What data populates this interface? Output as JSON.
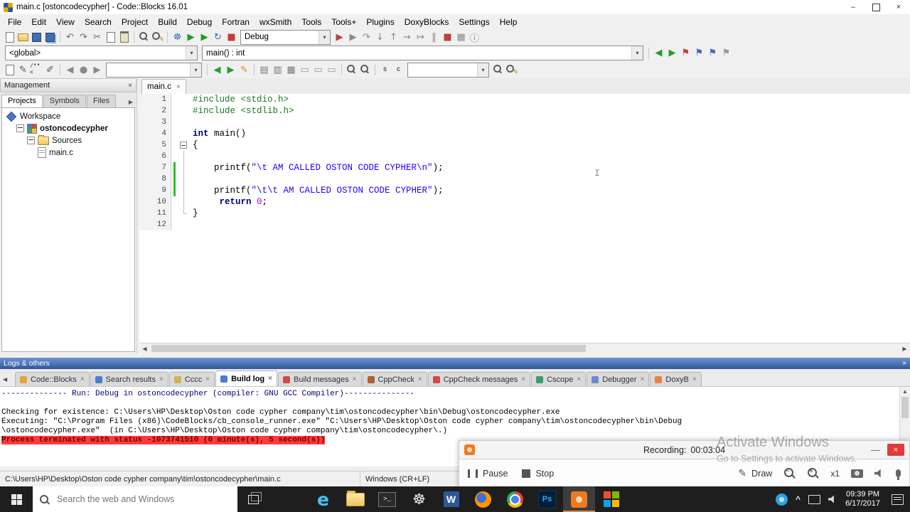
{
  "window": {
    "title": "main.c [ostoncodecypher] - Code::Blocks 16.01",
    "minimize": "–",
    "close": "×"
  },
  "menubar": {
    "items": [
      "File",
      "Edit",
      "View",
      "Search",
      "Project",
      "Build",
      "Debug",
      "Fortran",
      "wxSmith",
      "Tools",
      "Tools+",
      "Plugins",
      "DoxyBlocks",
      "Settings",
      "Help"
    ]
  },
  "toolbars": {
    "row1_file": [
      {
        "name": "new-file-icon",
        "shape": "doc"
      },
      {
        "name": "open-file-icon",
        "shape": "folder"
      },
      {
        "name": "save-file-icon",
        "shape": "floppy"
      },
      {
        "name": "save-all-files-icon",
        "shape": "floppy2"
      }
    ],
    "row1_edit": [
      {
        "name": "undo-icon",
        "glyph": "↶"
      },
      {
        "name": "redo-icon",
        "glyph": "↷"
      },
      {
        "name": "cut-icon",
        "glyph": "✂"
      },
      {
        "name": "copy-icon",
        "shape": "doc"
      },
      {
        "name": "paste-icon",
        "shape": "clip"
      }
    ],
    "row1_find": [
      {
        "name": "find-icon",
        "shape": "mag"
      },
      {
        "name": "replace-icon",
        "shape": "magpen"
      }
    ],
    "row1_build": [
      {
        "name": "build-icon",
        "glyph": "☸",
        "color": "#3f6fb5"
      },
      {
        "name": "run-icon",
        "glyph": "▶",
        "color": "#18a018"
      },
      {
        "name": "build-and-run-icon",
        "glyph": "▶",
        "color": "#18a018"
      },
      {
        "name": "rebuild-icon",
        "glyph": "↻",
        "color": "#3f6fb5"
      },
      {
        "name": "abort-build-icon",
        "glyph": "■",
        "color": "#c43c3c"
      }
    ],
    "debug_target": "Debug",
    "row1_debug": [
      {
        "name": "debug-continue-icon",
        "glyph": "▶",
        "color": "#c43c3c"
      },
      {
        "name": "run-to-cursor-icon",
        "glyph": "▶",
        "color": "#8a8a8a"
      },
      {
        "name": "next-line-icon",
        "glyph": "↷",
        "color": "#8a8a8a"
      },
      {
        "name": "step-into-icon",
        "glyph": "↓",
        "color": "#8a8a8a"
      },
      {
        "name": "step-out-icon",
        "glyph": "↑",
        "color": "#8a8a8a"
      },
      {
        "name": "next-instruction-icon",
        "glyph": "→",
        "color": "#8a8a8a"
      },
      {
        "name": "step-into-instruction-icon",
        "glyph": "↦",
        "color": "#8a8a8a"
      },
      {
        "name": "break-debugger-icon",
        "glyph": "‖",
        "color": "#8a8a8a"
      },
      {
        "name": "stop-debugger-icon",
        "glyph": "■",
        "color": "#c43c3c"
      },
      {
        "name": "debugging-windows-icon",
        "glyph": "▦",
        "color": "#8a8a8a"
      },
      {
        "name": "debug-info-icon",
        "glyph": "ⓘ",
        "color": "#8a8a8a"
      }
    ],
    "scope_combo": "<global>",
    "function_combo": "main() : int",
    "row2_icons": [
      {
        "name": "goto-prev-function-icon",
        "glyph": "◀",
        "color": "#2a9c2a"
      },
      {
        "name": "goto-next-function-icon",
        "glyph": "▶",
        "color": "#2a9c2a"
      },
      {
        "name": "toggle-bookmark-icon",
        "glyph": "⚑",
        "color": "#c43c3c"
      },
      {
        "name": "prev-bookmark-icon",
        "glyph": "⚑",
        "color": "#3f6fb5"
      },
      {
        "name": "next-bookmark-icon",
        "glyph": "⚑",
        "color": "#3f6fb5"
      },
      {
        "name": "clear-bookmarks-icon",
        "glyph": "⚑",
        "color": "#9a9a9a"
      }
    ],
    "row3_doxy": [
      {
        "name": "doxy-extract-icon",
        "shape": "doc"
      },
      {
        "name": "doxy-wizard-icon",
        "glyph": "✎",
        "color": "#555555"
      },
      {
        "name": "doxy-block-comment-icon",
        "glyph": "/**<",
        "text_icon": true
      },
      {
        "name": "doxy-line-comment-icon",
        "glyph": "✐",
        "color": "#555555"
      }
    ],
    "row3_nav": [
      {
        "name": "browse-back-icon",
        "glyph": "◀",
        "color": "#8a8a8a"
      },
      {
        "name": "browse-marker-icon",
        "glyph": "●",
        "color": "#8a8a8a"
      },
      {
        "name": "browse-forward-icon",
        "glyph": "▶",
        "color": "#8a8a8a"
      }
    ],
    "row3_combo1": "",
    "row3_edit": [
      {
        "name": "jump-back-icon",
        "glyph": "◀",
        "color": "#2a9c2a"
      },
      {
        "name": "jump-forward-icon",
        "glyph": "▶",
        "color": "#2a9c2a"
      },
      {
        "name": "highlight-pen-icon",
        "glyph": "✎",
        "color": "#c09a10"
      }
    ],
    "row3_align": [
      {
        "name": "align-box-1-icon",
        "glyph": "▤",
        "color": "#777777"
      },
      {
        "name": "align-box-2-icon",
        "glyph": "▥",
        "color": "#777777"
      },
      {
        "name": "align-box-3-icon",
        "glyph": "▦",
        "color": "#777777"
      },
      {
        "name": "frame-1-icon",
        "glyph": "▭",
        "color": "#9a9a9a"
      },
      {
        "name": "frame-2-icon",
        "glyph": "▭",
        "color": "#9a9a9a"
      },
      {
        "name": "frame-3-icon",
        "glyph": "▭",
        "color": "#9a9a9a"
      }
    ],
    "row3_zoom": [
      {
        "name": "zoom-out-icon",
        "shape": "mag"
      },
      {
        "name": "zoom-in-icon",
        "shape": "mag"
      }
    ],
    "row3_letters": [
      {
        "name": "style-s-icon",
        "glyph": "S",
        "text_icon": true
      },
      {
        "name": "style-c-icon",
        "glyph": "C",
        "text_icon": true
      }
    ],
    "row3_combo2": "",
    "row3_search": [
      {
        "name": "search-files-icon",
        "shape": "mag"
      },
      {
        "name": "search-replace-files-icon",
        "shape": "magpen"
      }
    ]
  },
  "management": {
    "title": "Management",
    "close": "×",
    "overflow": "▶",
    "tabs": [
      {
        "label": "Projects",
        "active": true
      },
      {
        "label": "Symbols",
        "active": false
      },
      {
        "label": "Files",
        "active": false
      }
    ],
    "tree": [
      {
        "label": "Workspace",
        "depth": 0,
        "icon": "workspace",
        "expand": false,
        "bold": false
      },
      {
        "label": "ostoncodecypher",
        "depth": 1,
        "icon": "project",
        "expand": true,
        "bold": true
      },
      {
        "label": "Sources",
        "depth": 2,
        "icon": "folder",
        "expand": true,
        "bold": false
      },
      {
        "label": "main.c",
        "depth": 3,
        "icon": "cfile",
        "expand": false,
        "bold": false
      }
    ]
  },
  "editor": {
    "tab": "main.c",
    "tab_close": "×",
    "lines": [
      {
        "num": 1,
        "segments": [
          {
            "t": "#include <stdio.h>",
            "s": "pre"
          }
        ]
      },
      {
        "num": 2,
        "segments": [
          {
            "t": "#include <stdlib.h>",
            "s": "pre"
          }
        ]
      },
      {
        "num": 3,
        "segments": []
      },
      {
        "num": 4,
        "segments": [
          {
            "t": "int",
            "s": "kw"
          },
          {
            "t": " main()",
            "s": "pln"
          }
        ]
      },
      {
        "num": 5,
        "fold": "start",
        "segments": [
          {
            "t": "{",
            "s": "pln"
          }
        ]
      },
      {
        "num": 6,
        "fold": "mid",
        "segments": []
      },
      {
        "num": 7,
        "fold": "mid",
        "changed": true,
        "segments": [
          {
            "t": "    printf(",
            "s": "pln"
          },
          {
            "t": "\"\\t AM CALLED OSTON CODE CYPHER\\n\"",
            "s": "str"
          },
          {
            "t": ");",
            "s": "pln"
          }
        ]
      },
      {
        "num": 8,
        "fold": "mid",
        "changed": true,
        "segments": []
      },
      {
        "num": 9,
        "fold": "mid",
        "changed": true,
        "segments": [
          {
            "t": "    printf(",
            "s": "pln"
          },
          {
            "t": "\"\\t\\t AM CALLED OSTON CODE CYPHER\"",
            "s": "str"
          },
          {
            "t": ");",
            "s": "pln"
          }
        ]
      },
      {
        "num": 10,
        "fold": "mid",
        "segments": [
          {
            "t": "     ",
            "s": "pln"
          },
          {
            "t": "return",
            "s": "kw"
          },
          {
            "t": " ",
            "s": "pln"
          },
          {
            "t": "0",
            "s": "num"
          },
          {
            "t": ";",
            "s": "pln"
          }
        ]
      },
      {
        "num": 11,
        "fold": "end",
        "segments": [
          {
            "t": "}",
            "s": "pln"
          }
        ]
      },
      {
        "num": 12,
        "segments": []
      }
    ]
  },
  "logs": {
    "title": "Logs & others",
    "close": "×",
    "tab_close": "×",
    "tabs": [
      {
        "label": "Code::Blocks",
        "color": "#e8a33d",
        "active": false
      },
      {
        "label": "Search results",
        "color": "#4a7ed0",
        "active": false
      },
      {
        "label": "Cccc",
        "color": "#c9b458",
        "active": false
      },
      {
        "label": "Build log",
        "color": "#4a7ed0",
        "active": true
      },
      {
        "label": "Build messages",
        "color": "#d04a4a",
        "active": false
      },
      {
        "label": "CppCheck",
        "color": "#b06030",
        "active": false
      },
      {
        "label": "CppCheck messages",
        "color": "#d04a4a",
        "active": false
      },
      {
        "label": "Cscope",
        "color": "#3aa06a",
        "active": false
      },
      {
        "label": "Debugger",
        "color": "#6a8ad0",
        "active": false
      },
      {
        "label": "DoxyB",
        "color": "#e8833d",
        "active": false
      }
    ],
    "lines": [
      {
        "text": "-------------- Run: Debug in ostoncodecypher (compiler: GNU GCC Compiler)---------------",
        "style": "run"
      },
      {
        "text": ""
      },
      {
        "text": "Checking for existence: C:\\Users\\HP\\Desktop\\Oston code cypher company\\tim\\ostoncodecypher\\bin\\Debug\\ostoncodecypher.exe",
        "style": ""
      },
      {
        "text": "Executing: \"C:\\Program Files (x86)\\CodeBlocks/cb_console_runner.exe\" \"C:\\Users\\HP\\Desktop\\Oston code cypher company\\tim\\ostoncodecypher\\bin\\Debug",
        "style": ""
      },
      {
        "text": "\\ostoncodecypher.exe\"  (in C:\\Users\\HP\\Desktop\\Oston code cypher company\\tim\\ostoncodecypher\\.)",
        "style": ""
      },
      {
        "text": "Process terminated with status -1073741510 (0 minute(s), 5 second(s))",
        "style": "error"
      }
    ]
  },
  "statusbar": {
    "path": "C:\\Users\\HP\\Desktop\\Oston code cypher company\\tim\\ostoncodecypher\\main.c",
    "encoding": "Windows (CR+LF)"
  },
  "watermark": {
    "line1": "Activate Windows",
    "line2": "Go to Settings to activate Windows."
  },
  "recorder": {
    "label": "Recording:",
    "time": "00:03:04",
    "minimize": "—",
    "close": "×",
    "pause": "Pause",
    "stop": "Stop",
    "draw": "Draw",
    "zoom_level": "x1"
  },
  "taskbar": {
    "search_placeholder": "Search the web and Windows",
    "time": "09:39 PM",
    "date": "6/17/2017",
    "apps": [
      {
        "name": "taskbar-edge-icon",
        "kind": "edge",
        "glyph": "e",
        "active": false
      },
      {
        "name": "taskbar-file-explorer-icon",
        "kind": "folder",
        "active": false
      },
      {
        "name": "taskbar-command-prompt-icon",
        "kind": "cmd",
        "glyph": ">_",
        "active": false
      },
      {
        "name": "taskbar-settings-icon",
        "kind": "gear",
        "glyph": "☸",
        "active": false
      },
      {
        "name": "taskbar-word-icon",
        "kind": "word",
        "glyph": "W",
        "active": false
      },
      {
        "name": "taskbar-firefox-icon",
        "kind": "firefox",
        "active": false
      },
      {
        "name": "taskbar-chrome-icon",
        "kind": "chrome",
        "active": false
      },
      {
        "name": "taskbar-photoshop-icon",
        "kind": "ps",
        "glyph": "Ps",
        "active": false
      },
      {
        "name": "taskbar-recorder-icon",
        "kind": "recorder",
        "active": true
      },
      {
        "name": "taskbar-office-icon",
        "kind": "grid4",
        "active": false
      }
    ]
  }
}
